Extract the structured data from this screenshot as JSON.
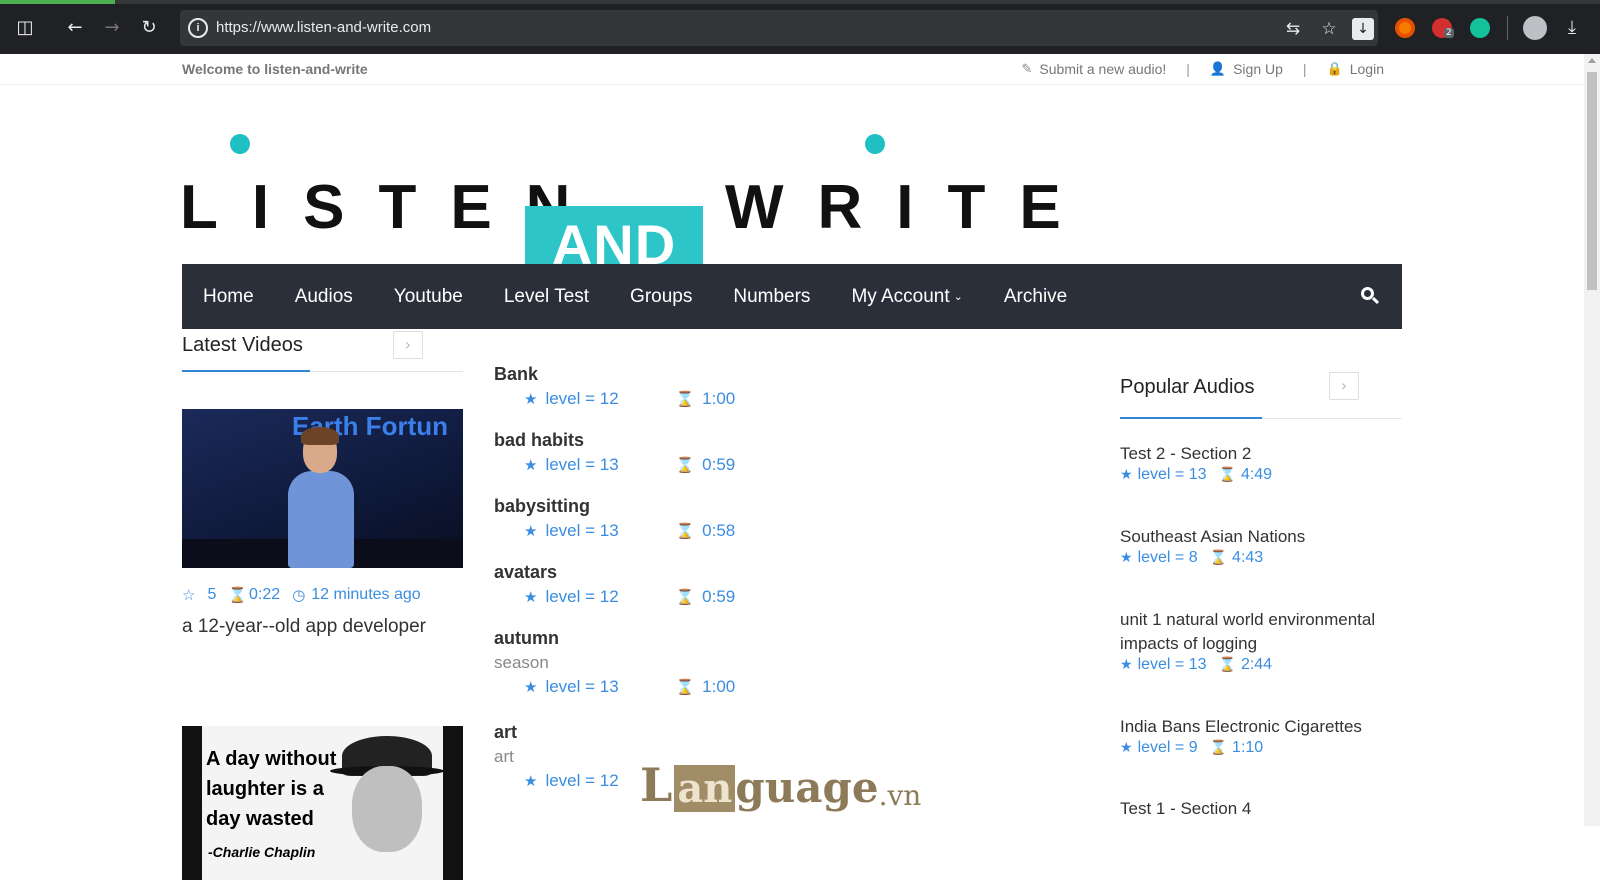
{
  "browser": {
    "url": "https://www.listen-and-write.com",
    "extension_badge": "2"
  },
  "topbar": {
    "welcome": "Welcome to listen-and-write",
    "submit": "Submit a new audio!",
    "signup": "Sign Up",
    "login": "Login",
    "separator": "|"
  },
  "logo": {
    "word1": "LISTEN",
    "word2": "AND",
    "word3": "WRITE",
    "accent": "#2ec5c8"
  },
  "nav": {
    "items": [
      "Home",
      "Audios",
      "Youtube",
      "Level Test",
      "Groups",
      "Numbers",
      "My Account",
      "Archive"
    ]
  },
  "latest_videos": {
    "title": "Latest Videos",
    "video1": {
      "banner": "Earth Fortun",
      "stars": "5",
      "duration": "0:22",
      "time_ago": "12 minutes ago",
      "title": "a 12-year--old app developer"
    },
    "video2": {
      "quote": [
        "A day without",
        "laughter is a",
        "day wasted"
      ],
      "author": "-Charlie Chaplin"
    }
  },
  "audio_list": [
    {
      "title": "Bank",
      "subtitle": "",
      "level": "level = 12",
      "duration": "1:00"
    },
    {
      "title": "bad habits",
      "subtitle": "",
      "level": "level = 13",
      "duration": "0:59"
    },
    {
      "title": "babysitting",
      "subtitle": "",
      "level": "level = 13",
      "duration": "0:58"
    },
    {
      "title": "avatars",
      "subtitle": "",
      "level": "level = 12",
      "duration": "0:59"
    },
    {
      "title": "autumn",
      "subtitle": "season",
      "level": "level = 13",
      "duration": "1:00"
    },
    {
      "title": "art",
      "subtitle": "art",
      "level": "level = 12",
      "duration": ""
    }
  ],
  "popular_audios": {
    "title": "Popular Audios",
    "items": [
      {
        "title": "Test 2 - Section 2",
        "level": "level = 13",
        "duration": "4:49"
      },
      {
        "title": "Southeast Asian Nations",
        "level": "level = 8",
        "duration": "4:43"
      },
      {
        "title": "unit 1 natural world environmental impacts of logging",
        "level": "level = 13",
        "duration": "2:44"
      },
      {
        "title": "India Bans Electronic Cigarettes",
        "level": "level = 9",
        "duration": "1:10"
      },
      {
        "title": "Test 1 - Section 4",
        "level": "",
        "duration": ""
      }
    ]
  },
  "watermark": {
    "l": "L",
    "boxed": "an",
    "rest": "guage",
    "tld": ".vn"
  }
}
